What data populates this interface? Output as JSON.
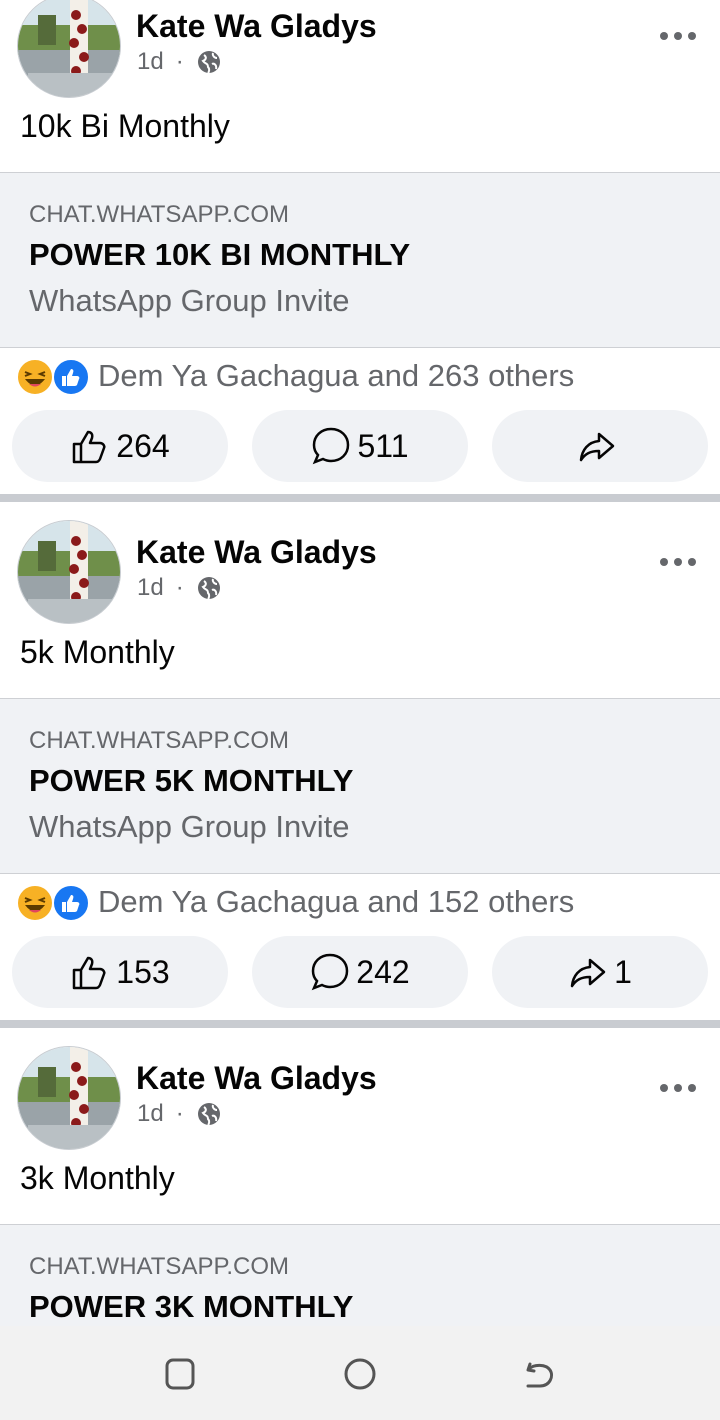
{
  "posts": [
    {
      "author": "Kate Wa Gladys",
      "time": "1d",
      "text": "10k Bi Monthly",
      "link": {
        "domain": "CHAT.WHATSAPP.COM",
        "title": "POWER 10K BI MONTHLY",
        "subtitle": "WhatsApp Group Invite"
      },
      "reactions_text": "Dem Ya Gachagua and 263 others",
      "likes": "264",
      "comments": "511",
      "shares": ""
    },
    {
      "author": "Kate Wa Gladys",
      "time": "1d",
      "text": "5k Monthly",
      "link": {
        "domain": "CHAT.WHATSAPP.COM",
        "title": "POWER 5K MONTHLY",
        "subtitle": "WhatsApp Group Invite"
      },
      "reactions_text": "Dem Ya Gachagua and 152 others",
      "likes": "153",
      "comments": "242",
      "shares": "1"
    },
    {
      "author": "Kate Wa Gladys",
      "time": "1d",
      "text": "3k Monthly",
      "link": {
        "domain": "CHAT.WHATSAPP.COM",
        "title": "POWER 3K MONTHLY",
        "subtitle": ""
      }
    }
  ],
  "icons": {
    "audience": "globe-icon",
    "reaction_1": "haha-reaction-icon",
    "reaction_2": "like-reaction-icon",
    "nav": [
      "recent-apps-icon",
      "home-icon",
      "back-icon"
    ]
  },
  "colors": {
    "like_blue": "#1877f2",
    "haha_yellow": "#f7b125",
    "secondary_text": "#65676b",
    "card_bg": "#f0f2f5"
  }
}
